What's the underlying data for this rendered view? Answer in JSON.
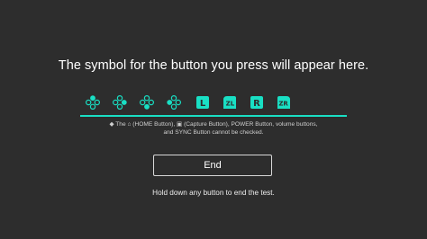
{
  "screen": {
    "prompt": "The symbol for the button you press will appear here.",
    "note_line1": "The ⌂ (HOME Button), ▣ (Capture Button), POWER Button, volume buttons,",
    "note_line2": "and SYNC Button cannot be checked.",
    "note_bullet": "◆",
    "end_label": "End",
    "hold_text": "Hold down any button to end the test.",
    "accent_color": "#19dfc4"
  },
  "pressed_buttons": [
    {
      "icon": "dpad-up-icon"
    },
    {
      "icon": "dpad-right-icon"
    },
    {
      "icon": "dpad-down-icon"
    },
    {
      "icon": "dpad-left-icon"
    },
    {
      "icon": "l-button-icon",
      "label": "L"
    },
    {
      "icon": "zl-button-icon",
      "label": "ZL"
    },
    {
      "icon": "r-button-icon",
      "label": "R"
    },
    {
      "icon": "zr-button-icon",
      "label": "ZR"
    }
  ]
}
